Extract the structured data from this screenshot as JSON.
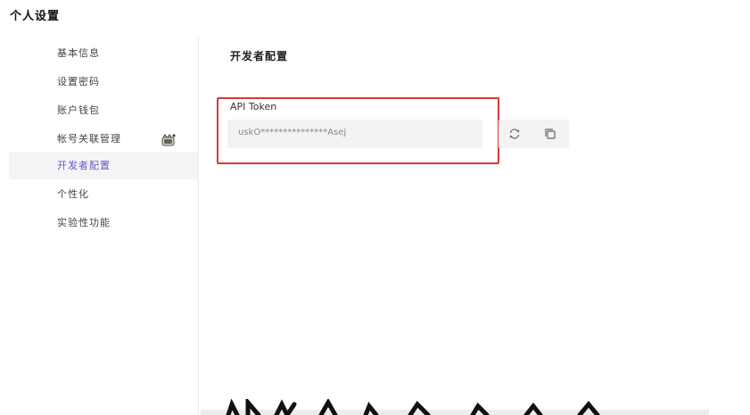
{
  "header": {
    "title": "个人设置"
  },
  "sidebar": {
    "items": [
      {
        "label": "基本信息"
      },
      {
        "label": "设置密码"
      },
      {
        "label": "账户钱包"
      },
      {
        "label": "帐号关联管理"
      },
      {
        "label": "开发者配置"
      },
      {
        "label": "个性化"
      },
      {
        "label": "实验性功能"
      }
    ],
    "active_index": 4
  },
  "main": {
    "section_title": "开发者配置",
    "api_token": {
      "label": "API Token",
      "value": "uskO***************Asej"
    }
  },
  "colors": {
    "accent": "#6d55c9",
    "highlight_border": "#d63a3a",
    "field_bg": "#f3f3f3"
  },
  "icons": {
    "refresh": "refresh-icon",
    "copy": "copy-icon",
    "badge": "badge-icon"
  }
}
